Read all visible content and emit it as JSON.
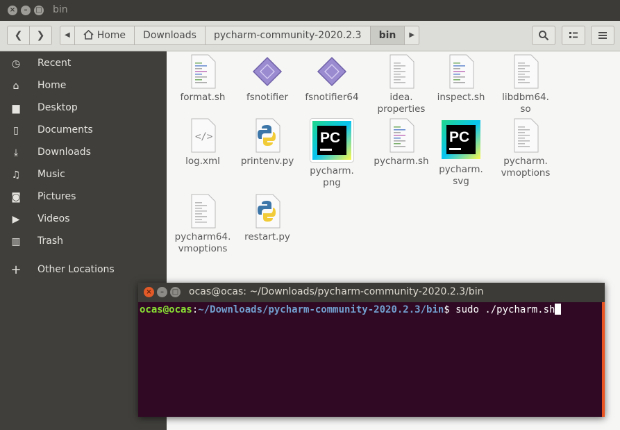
{
  "window": {
    "title": "bin"
  },
  "toolbar": {
    "back_glyph": "❮",
    "forward_glyph": "❯",
    "crumbs": [
      "Home",
      "Downloads",
      "pycharm-community-2020.2.3",
      "bin"
    ],
    "search_icon": "search-icon",
    "view_icon": "grid-view-icon",
    "menu_icon": "hamburger-menu-icon"
  },
  "sidebar": {
    "items": [
      {
        "label": "Recent",
        "icon": "clock-icon"
      },
      {
        "label": "Home",
        "icon": "home-icon"
      },
      {
        "label": "Desktop",
        "icon": "folder-icon"
      },
      {
        "label": "Documents",
        "icon": "document-icon"
      },
      {
        "label": "Downloads",
        "icon": "download-icon"
      },
      {
        "label": "Music",
        "icon": "music-icon"
      },
      {
        "label": "Pictures",
        "icon": "camera-icon"
      },
      {
        "label": "Videos",
        "icon": "video-icon"
      },
      {
        "label": "Trash",
        "icon": "trash-icon"
      },
      {
        "label": "Other Locations",
        "icon": "plus-icon"
      }
    ]
  },
  "files": [
    {
      "name": "format.sh",
      "type": "script"
    },
    {
      "name": "fsnotifier",
      "type": "binary"
    },
    {
      "name": "fsnotifier64",
      "type": "binary"
    },
    {
      "name": "idea.\nproperties",
      "type": "text"
    },
    {
      "name": "inspect.sh",
      "type": "script"
    },
    {
      "name": "libdbm64.\nso",
      "type": "text"
    },
    {
      "name": "log.xml",
      "type": "xml"
    },
    {
      "name": "printenv.py",
      "type": "python"
    },
    {
      "name": "pycharm.\npng",
      "type": "pycharm"
    },
    {
      "name": "pycharm.sh",
      "type": "script"
    },
    {
      "name": "pycharm.\nsvg",
      "type": "pycharm"
    },
    {
      "name": "pycharm.\nvmoptions",
      "type": "text"
    },
    {
      "name": "pycharm64.\nvmoptions",
      "type": "text"
    },
    {
      "name": "restart.py",
      "type": "python"
    }
  ],
  "terminal": {
    "title": "ocas@ocas: ~/Downloads/pycharm-community-2020.2.3/bin",
    "prompt_user": "ocas@ocas",
    "prompt_sep": ":",
    "prompt_path": "~/Downloads/pycharm-community-2020.2.3/bin",
    "prompt_symbol": "$ ",
    "command": "sudo ./pycharm.sh"
  }
}
